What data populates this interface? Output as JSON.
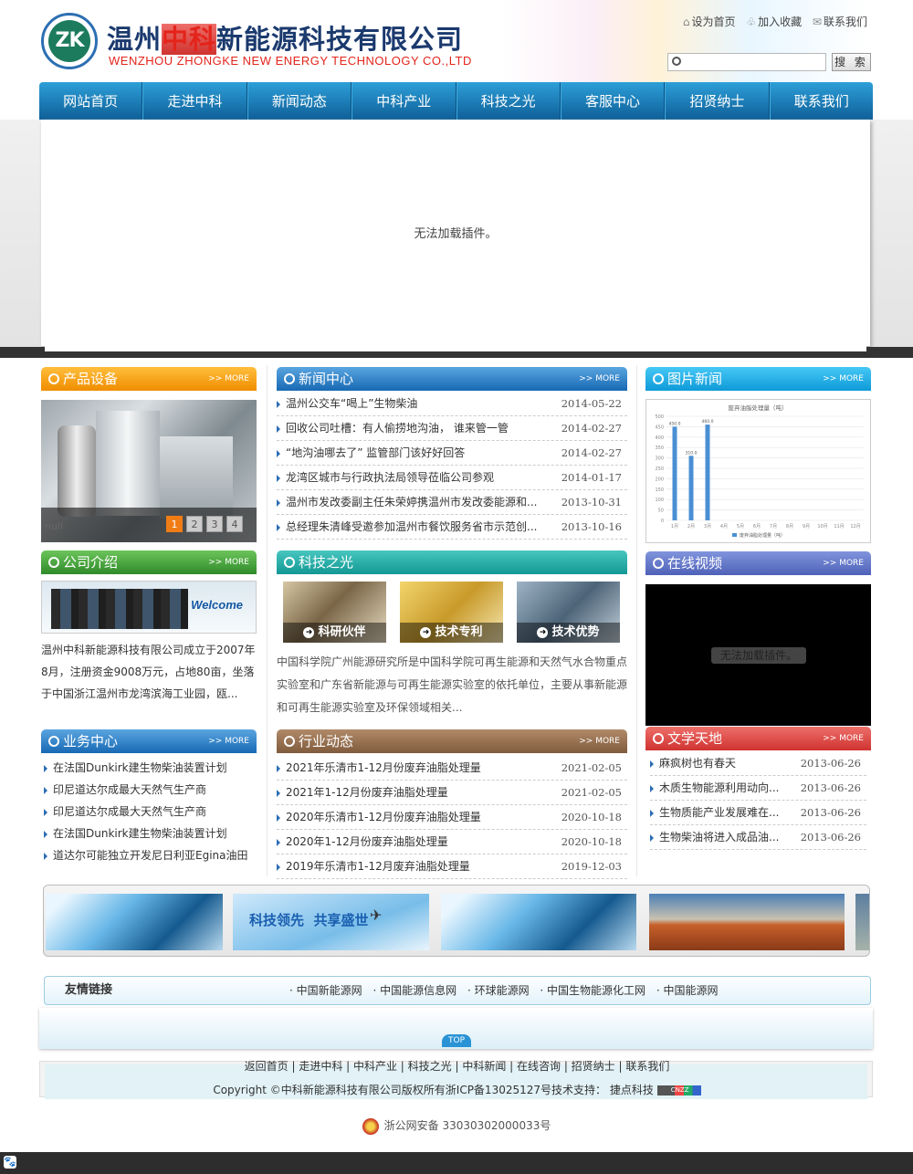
{
  "header": {
    "logo_mark": "ZK",
    "company_cn_a": "温州",
    "company_cn_b": "中科",
    "company_cn_c": "新能源科技有限公司",
    "company_en": "WENZHOU ZHONGKE NEW ENERGY TECHNOLOGY CO.,LTD",
    "toplinks": [
      "设为首页",
      "加入收藏",
      "联系我们"
    ],
    "search_placeholder": "",
    "search_button": "搜 索"
  },
  "nav": [
    "网站首页",
    "走进中科",
    "新闻动态",
    "中科产业",
    "科技之光",
    "客服中心",
    "招贤纳士",
    "联系我们"
  ],
  "banner": {
    "message": "无法加载插件。"
  },
  "more_label": ">> MORE",
  "products": {
    "title": "产品设备",
    "caption": "null",
    "pages": [
      "1",
      "2",
      "3",
      "4"
    ]
  },
  "news": {
    "title": "新闻中心",
    "items": [
      {
        "text": "温州公交车“喝上”生物柴油",
        "date": "2014-05-22"
      },
      {
        "text": "回收公司吐槽：有人偷捞地沟油， 谁来管一管",
        "date": "2014-02-27"
      },
      {
        "text": "“地沟油哪去了” 监管部门该好好回答",
        "date": "2014-02-27"
      },
      {
        "text": "龙湾区城市与行政执法局领导莅临公司参观",
        "date": "2014-01-17"
      },
      {
        "text": "温州市发改委副主任朱荣婷携温州市发改委能源和...",
        "date": "2013-10-31"
      },
      {
        "text": "总经理朱清峰受邀参加温州市餐饮服务省市示范创...",
        "date": "2013-10-16"
      }
    ]
  },
  "photo_news": {
    "title": "图片新闻"
  },
  "chart_data": {
    "type": "bar",
    "title": "废弃油脂处理量（吨）",
    "categories": [
      "1月",
      "2月",
      "3月",
      "4月",
      "5月",
      "6月",
      "7月",
      "8月",
      "9月",
      "10月",
      "11月",
      "12月"
    ],
    "series": [
      {
        "name": "废弃油脂处理量（吨）",
        "values": [
          450,
          310,
          460,
          0,
          0,
          0,
          0,
          0,
          0,
          0,
          0,
          0
        ]
      }
    ],
    "ylim": [
      0,
      500
    ],
    "yticks": [
      "0",
      "50",
      "100",
      "150",
      "200",
      "250",
      "300",
      "350",
      "400",
      "450",
      "500"
    ],
    "data_labels": [
      "450.0",
      "310.0",
      "460.0"
    ],
    "legend": "bottom"
  },
  "intro": {
    "title": "公司介绍",
    "welcome": "Welcome",
    "text": "温州中科新能源科技有限公司成立于2007年8月，注册资金9008万元，占地80亩，坐落于中国浙江温州市龙湾滨海工业园，瓯..."
  },
  "tech": {
    "title": "科技之光",
    "thumbs": [
      "科研伙伴",
      "技术专利",
      "技术优势"
    ],
    "text": "中国科学院广州能源研究所是中国科学院可再生能源和天然气水合物重点实验室和广东省新能源与可再生能源实验室的依托单位，主要从事新能源和可再生能源实验室及环保领域相关..."
  },
  "video": {
    "title": "在线视频",
    "message": "无法加载插件。"
  },
  "business": {
    "title": "业务中心",
    "items": [
      "在法国Dunkirk建生物柴油装置计划",
      "印尼道达尔成最大天然气生产商",
      "印尼道达尔成最大天然气生产商",
      "在法国Dunkirk建生物柴油装置计划",
      "道达尔可能独立开发尼日利亚Egina油田"
    ]
  },
  "industry": {
    "title": "行业动态",
    "items": [
      {
        "text": "2021年乐清市1-12月份废弃油脂处理量",
        "date": "2021-02-05"
      },
      {
        "text": "2021年1-12月份废弃油脂处理量",
        "date": "2021-02-05"
      },
      {
        "text": "2020年乐清市1-12月份废弃油脂处理量",
        "date": "2020-10-18"
      },
      {
        "text": "2020年1-12月份废弃油脂处理量",
        "date": "2020-10-18"
      },
      {
        "text": "2019年乐清市1-12月废弃油脂处理量",
        "date": "2019-12-03"
      }
    ]
  },
  "literature": {
    "title": "文学天地",
    "items": [
      {
        "text": "麻疯树也有春天",
        "date": "2013-06-26"
      },
      {
        "text": "木质生物能源利用动向...",
        "date": "2013-06-26"
      },
      {
        "text": "生物质能产业发展难在...",
        "date": "2013-06-26"
      },
      {
        "text": "生物柴油将进入成品油...",
        "date": "2013-06-26"
      }
    ]
  },
  "strip": {
    "slogan": "科技领先  共享盛世"
  },
  "friends": {
    "label": "友情链接",
    "links": [
      "· 中国新能源网",
      "· 中国能源信息网",
      "· 环球能源网",
      "· 中国生物能源化工网",
      "· 中国能源网"
    ]
  },
  "top_label": "TOP",
  "footer": {
    "links": "返回首页 | 走进中科 | 中科产业 | 科技之光 | 中科新闻 | 在线咨询 | 招贤纳士 | 联系我们",
    "copyright": "Copyright ©中科新能源科技有限公司版权所有浙ICP备13025127号技术支持： 捷点科技",
    "badge": "CNZZ",
    "police": "浙公网安备 33030302000033号"
  },
  "colors": {
    "nav": "#1769b4",
    "accent_orange": "#f08d00",
    "bar": "#4a8fd4"
  }
}
